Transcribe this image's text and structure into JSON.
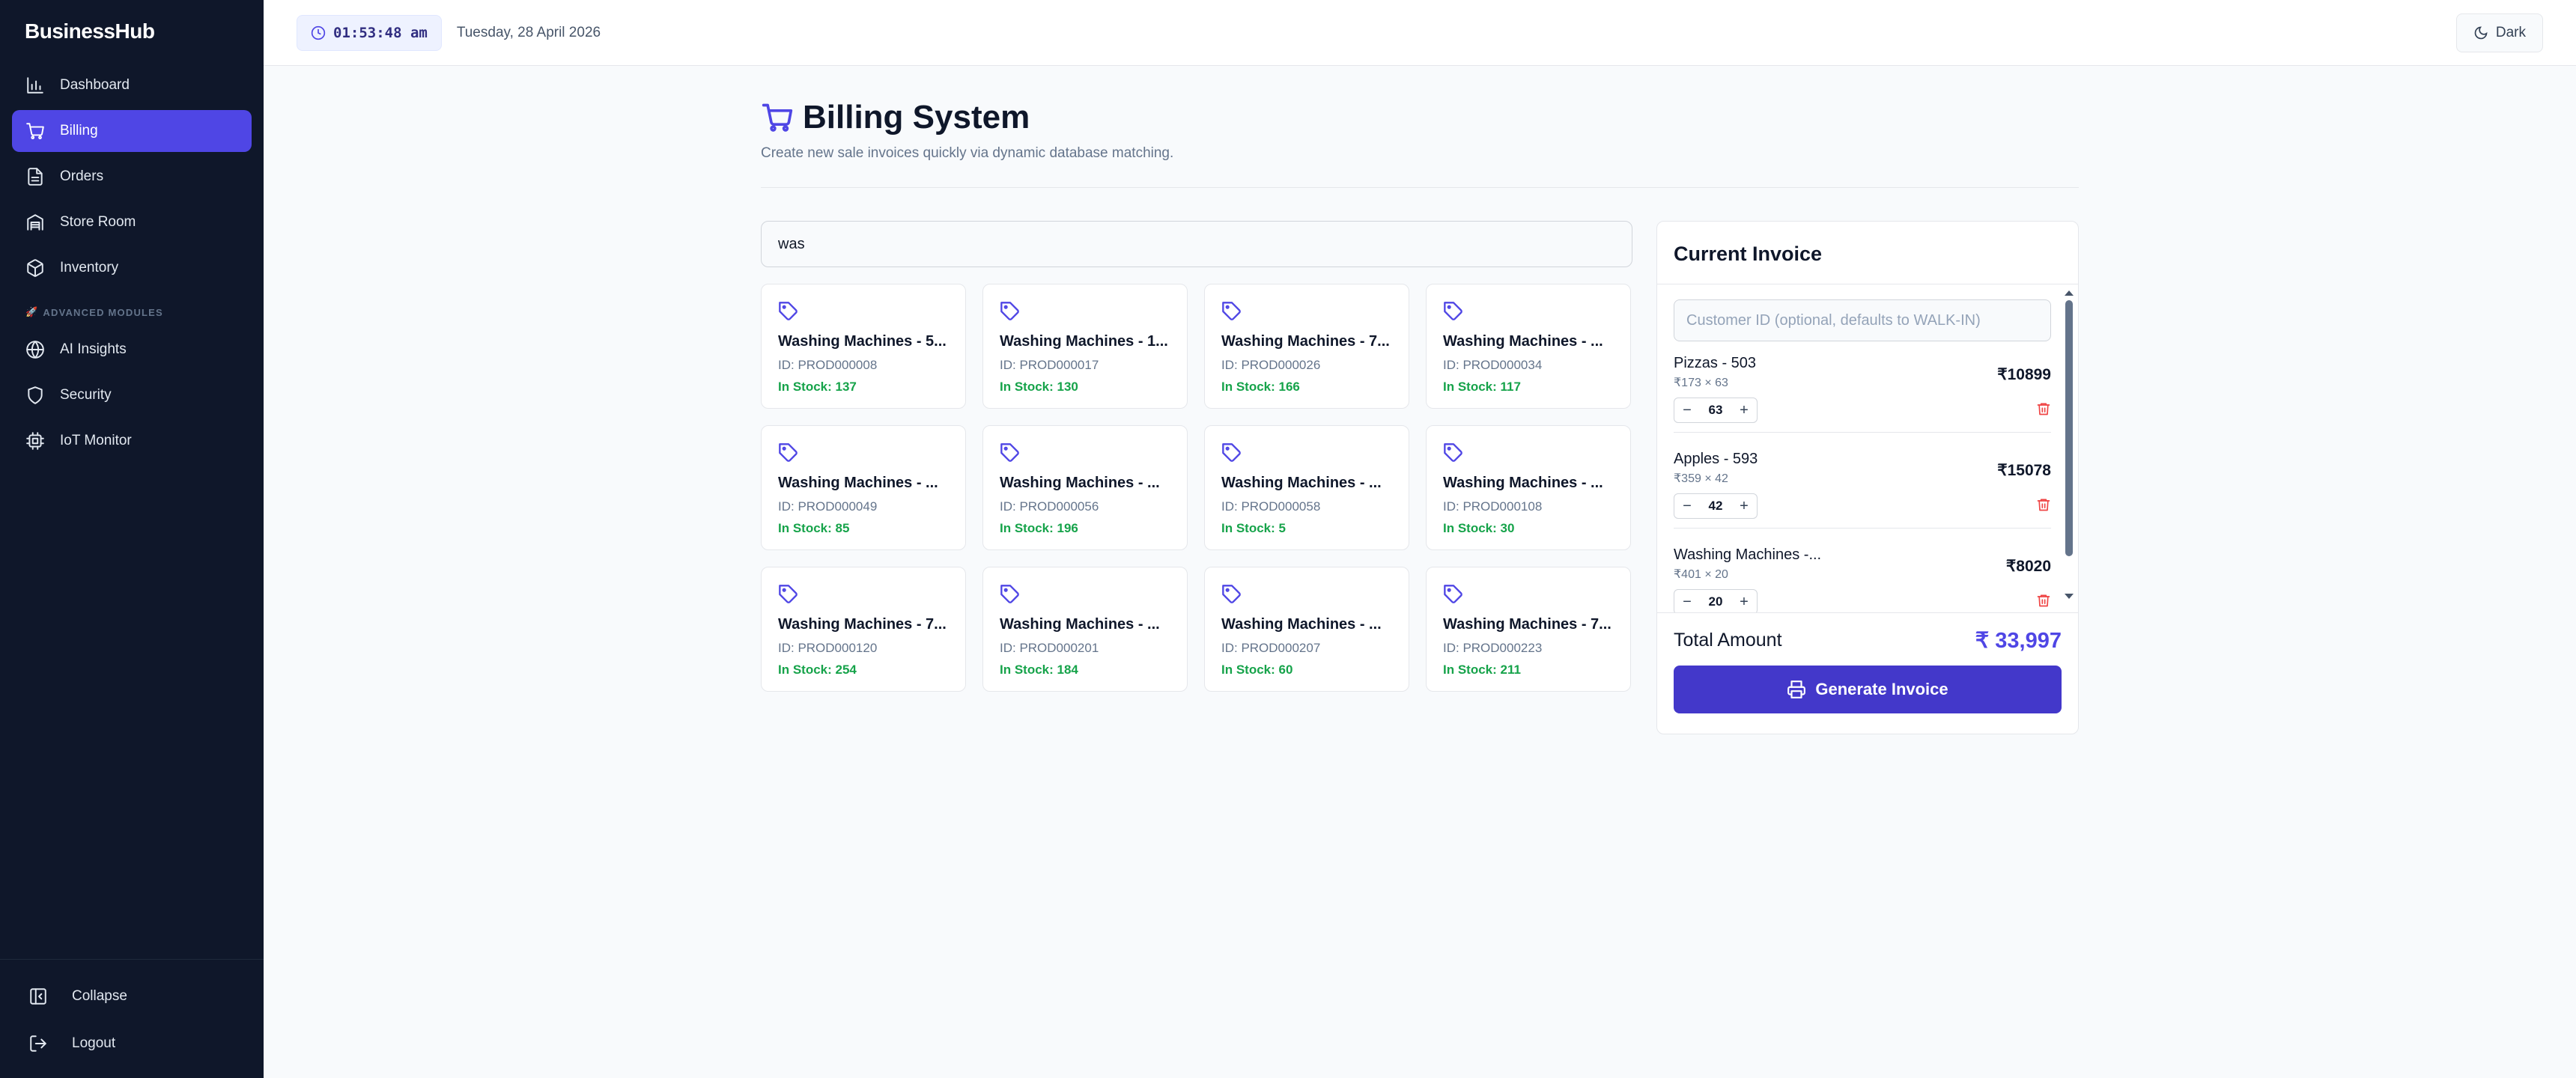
{
  "app": {
    "brand": "BusinessHub"
  },
  "sidebar": {
    "items": [
      {
        "label": "Dashboard",
        "icon": "bar-chart-icon"
      },
      {
        "label": "Billing",
        "icon": "shopping-cart-icon",
        "active": true
      },
      {
        "label": "Orders",
        "icon": "file-text-icon"
      },
      {
        "label": "Store Room",
        "icon": "warehouse-icon"
      },
      {
        "label": "Inventory",
        "icon": "package-icon"
      }
    ],
    "section_label": "ADVANCED MODULES",
    "section_icon": "rocket-icon",
    "advanced_items": [
      {
        "label": "AI Insights",
        "icon": "globe-icon"
      },
      {
        "label": "Security",
        "icon": "shield-icon"
      },
      {
        "label": "IoT Monitor",
        "icon": "cpu-icon"
      }
    ],
    "collapse_label": "Collapse",
    "logout_label": "Logout"
  },
  "header": {
    "time": "01:53:48 am",
    "date": "Tuesday, 28 April 2026",
    "theme_label": "Dark"
  },
  "page": {
    "title": "Billing System",
    "subtitle": "Create new sale invoices quickly via dynamic database matching."
  },
  "search": {
    "value": "was"
  },
  "products": [
    {
      "name": "Washing Machines - 5...",
      "id": "ID: PROD000008",
      "stock": "In Stock: 137"
    },
    {
      "name": "Washing Machines - 1...",
      "id": "ID: PROD000017",
      "stock": "In Stock: 130"
    },
    {
      "name": "Washing Machines - 7...",
      "id": "ID: PROD000026",
      "stock": "In Stock: 166"
    },
    {
      "name": "Washing Machines - ...",
      "id": "ID: PROD000034",
      "stock": "In Stock: 117"
    },
    {
      "name": "Washing Machines - ...",
      "id": "ID: PROD000049",
      "stock": "In Stock: 85"
    },
    {
      "name": "Washing Machines - ...",
      "id": "ID: PROD000056",
      "stock": "In Stock: 196"
    },
    {
      "name": "Washing Machines - ...",
      "id": "ID: PROD000058",
      "stock": "In Stock: 5"
    },
    {
      "name": "Washing Machines - ...",
      "id": "ID: PROD000108",
      "stock": "In Stock: 30"
    },
    {
      "name": "Washing Machines - 7...",
      "id": "ID: PROD000120",
      "stock": "In Stock: 254"
    },
    {
      "name": "Washing Machines - ...",
      "id": "ID: PROD000201",
      "stock": "In Stock: 184"
    },
    {
      "name": "Washing Machines - ...",
      "id": "ID: PROD000207",
      "stock": "In Stock: 60"
    },
    {
      "name": "Washing Machines - 7...",
      "id": "ID: PROD000223",
      "stock": "In Stock: 211"
    }
  ],
  "invoice": {
    "title": "Current Invoice",
    "customer_placeholder": "Customer ID (optional, defaults to WALK-IN)",
    "items": [
      {
        "name": "Pizzas - 503",
        "meta": "₹173 × 63",
        "total": "₹10899",
        "qty": "63"
      },
      {
        "name": "Apples - 593",
        "meta": "₹359 × 42",
        "total": "₹15078",
        "qty": "42"
      },
      {
        "name": "Washing Machines -...",
        "meta": "₹401 × 20",
        "total": "₹8020",
        "qty": "20"
      }
    ],
    "total_label": "Total Amount",
    "total_value": "₹ 33,997",
    "generate_label": "Generate Invoice"
  },
  "colors": {
    "accent": "#4f46e5",
    "sidebar_bg": "#0f172a",
    "stock_green": "#16a34a",
    "danger": "#ef4444"
  }
}
